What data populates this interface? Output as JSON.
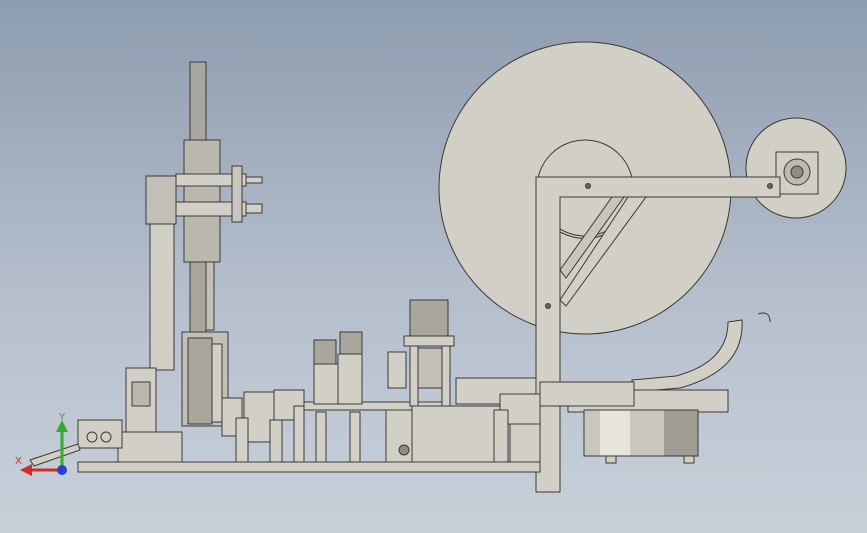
{
  "viewport": {
    "background_top": "#8e9cb0",
    "background_bottom": "#c9d0da",
    "part_fill": "#d2d0c6",
    "part_stroke": "#3a3a38",
    "part_shade": "#a9a79d"
  },
  "triad": {
    "y_label": "Y",
    "x_label": "X",
    "y_color": "#2fae2f",
    "x_color": "#d42a2a",
    "origin_color": "#2a3fd4"
  }
}
